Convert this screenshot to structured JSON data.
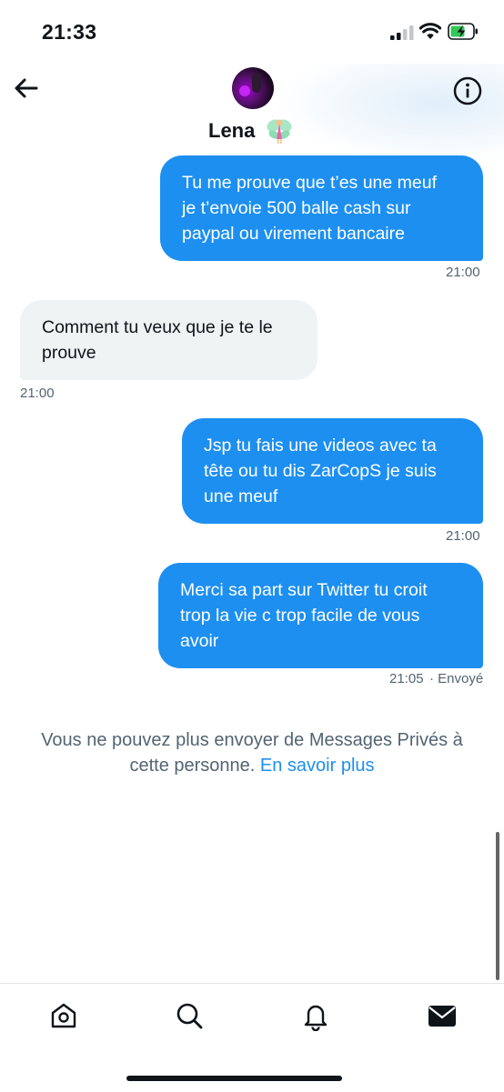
{
  "status_bar": {
    "time": "21:33"
  },
  "header": {
    "contact_name": "Lena",
    "name_emoji": "fairy-icon"
  },
  "messages": [
    {
      "direction": "out",
      "lines": [
        "Tu me prouve que t’es une meuf",
        "je t’envoie 500 balle cash sur",
        "paypal ou virement bancaire"
      ],
      "time": "21:00"
    },
    {
      "direction": "in",
      "lines": [
        "Comment tu veux que je te le",
        "prouve"
      ],
      "time": "21:00"
    },
    {
      "direction": "out",
      "lines": [
        "Jsp tu fais une videos avec ta",
        "tête ou tu dis ZarCopS je suis",
        "une meuf"
      ],
      "time": "21:00"
    },
    {
      "direction": "out",
      "lines": [
        "Merci sa part sur Twitter tu croit",
        "trop la vie c trop facile de vous",
        "avoir"
      ],
      "time": "21:05",
      "status": "· Envoyé"
    }
  ],
  "notice": {
    "line1": "Vous ne pouvez plus envoyer de Messages Privés à",
    "line2": "cette personne.",
    "link": "En savoir plus"
  },
  "tabs": [
    "home-icon",
    "search-icon",
    "notifications-icon",
    "messages-icon"
  ],
  "colors": {
    "accent": "#1d8ff0",
    "incoming_bubble": "#eff3f4",
    "muted_text": "#536471"
  }
}
